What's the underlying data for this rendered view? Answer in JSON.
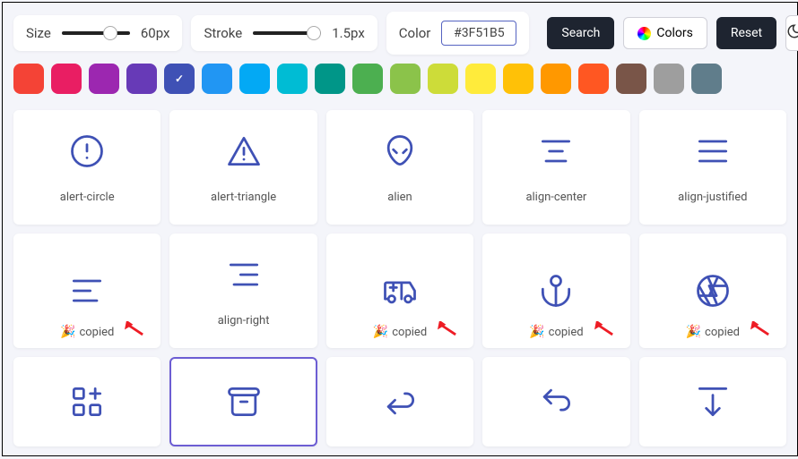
{
  "toolbar": {
    "size_label": "Size",
    "size_value": "60px",
    "stroke_label": "Stroke",
    "stroke_value": "1.5px",
    "color_label": "Color",
    "color_value": "#3F51B5",
    "search_label": "Search",
    "colors_label": "Colors",
    "reset_label": "Reset"
  },
  "swatches": [
    {
      "hex": "#f44336"
    },
    {
      "hex": "#e91e63"
    },
    {
      "hex": "#9c27b0"
    },
    {
      "hex": "#673ab7"
    },
    {
      "hex": "#3f51b5",
      "selected": true
    },
    {
      "hex": "#2196f3"
    },
    {
      "hex": "#03a9f4"
    },
    {
      "hex": "#00bcd4"
    },
    {
      "hex": "#009688"
    },
    {
      "hex": "#4caf50"
    },
    {
      "hex": "#8bc34a"
    },
    {
      "hex": "#cddc39"
    },
    {
      "hex": "#ffeb3b"
    },
    {
      "hex": "#ffc107"
    },
    {
      "hex": "#ff9800"
    },
    {
      "hex": "#ff5722"
    },
    {
      "hex": "#795548"
    },
    {
      "hex": "#9e9e9e"
    },
    {
      "hex": "#607d8b"
    }
  ],
  "copied_text": "copied",
  "icons": {
    "row1": [
      {
        "name": "alert-circle"
      },
      {
        "name": "alert-triangle"
      },
      {
        "name": "alien"
      },
      {
        "name": "align-center"
      },
      {
        "name": "align-justified"
      }
    ],
    "row2": [
      {
        "name": "align-left",
        "copied": true
      },
      {
        "name": "align-right"
      },
      {
        "name": "ambulance",
        "copied": true
      },
      {
        "name": "anchor",
        "copied": true
      },
      {
        "name": "aperture",
        "copied": true
      }
    ],
    "row3": [
      {
        "name": "apps"
      },
      {
        "name": "archive",
        "selected": true
      },
      {
        "name": "arrow-back"
      },
      {
        "name": "arrow-back-up"
      },
      {
        "name": "arrow-bar-down"
      }
    ]
  }
}
